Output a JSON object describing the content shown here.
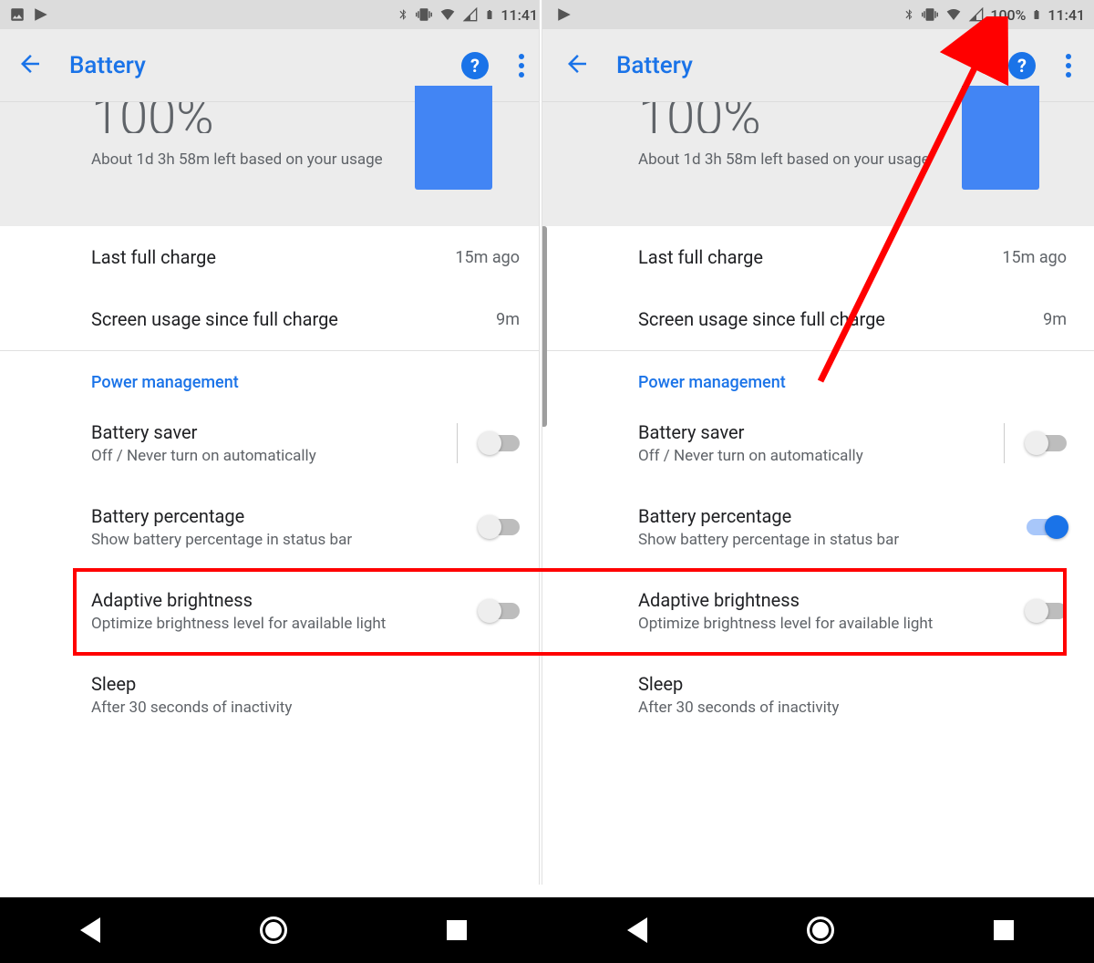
{
  "status": {
    "time": "11:41",
    "battery_pct": "100%"
  },
  "appbar": {
    "title": "Battery"
  },
  "hero": {
    "percent": "100%",
    "estimate": "About 1d 3h 58m left based on your usage"
  },
  "rows": {
    "last_charge_label": "Last full charge",
    "last_charge_val": "15m ago",
    "screen_usage_label": "Screen usage since full charge",
    "screen_usage_val": "9m"
  },
  "section": {
    "power_mgmt": "Power management"
  },
  "saver": {
    "title": "Battery saver",
    "sub": "Off / Never turn on automatically"
  },
  "pct_row": {
    "title": "Battery percentage",
    "sub": "Show battery percentage in status bar"
  },
  "adaptive": {
    "title": "Adaptive brightness",
    "sub": "Optimize brightness level for available light"
  },
  "sleep": {
    "title": "Sleep",
    "sub": "After 30 seconds of inactivity"
  }
}
